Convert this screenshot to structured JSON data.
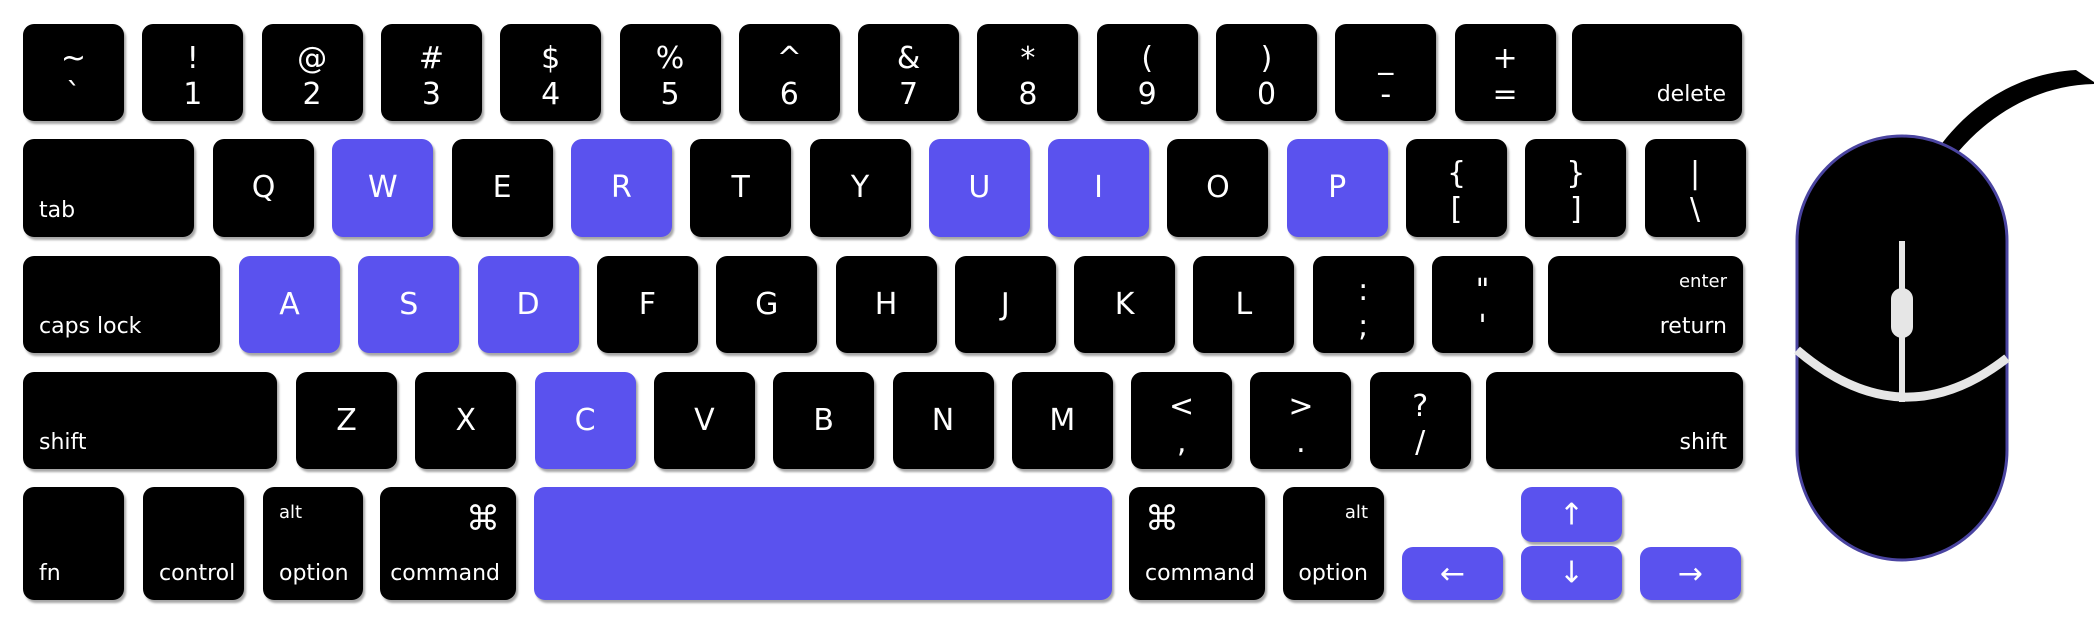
{
  "colors": {
    "highlight": "#5a52ee",
    "key": "#000000",
    "mouse_outline": "#4a44a0",
    "mouse_lines": "#e6e6e6"
  },
  "highlighted_keys": [
    "W",
    "R",
    "U",
    "I",
    "P",
    "A",
    "S",
    "D",
    "C",
    "space",
    "up",
    "down",
    "left",
    "right"
  ],
  "rows": [
    [
      {
        "id": "backtick",
        "top": "~",
        "bottom": "`"
      },
      {
        "id": "1",
        "top": "!",
        "bottom": "1"
      },
      {
        "id": "2",
        "top": "@",
        "bottom": "2"
      },
      {
        "id": "3",
        "top": "#",
        "bottom": "3"
      },
      {
        "id": "4",
        "top": "$",
        "bottom": "4"
      },
      {
        "id": "5",
        "top": "%",
        "bottom": "5"
      },
      {
        "id": "6",
        "top": "^",
        "bottom": "6"
      },
      {
        "id": "7",
        "top": "&",
        "bottom": "7"
      },
      {
        "id": "8",
        "top": "*",
        "bottom": "8"
      },
      {
        "id": "9",
        "top": "(",
        "bottom": "9"
      },
      {
        "id": "0",
        "top": ")",
        "bottom": "0"
      },
      {
        "id": "minus",
        "top": "_",
        "bottom": "-"
      },
      {
        "id": "equals",
        "top": "+",
        "bottom": "="
      },
      {
        "id": "delete",
        "label": "delete",
        "align": "right"
      }
    ],
    [
      {
        "id": "tab",
        "label": "tab",
        "align": "left"
      },
      {
        "id": "Q",
        "char": "Q"
      },
      {
        "id": "W",
        "char": "W"
      },
      {
        "id": "E",
        "char": "E"
      },
      {
        "id": "R",
        "char": "R"
      },
      {
        "id": "T",
        "char": "T"
      },
      {
        "id": "Y",
        "char": "Y"
      },
      {
        "id": "U",
        "char": "U"
      },
      {
        "id": "I",
        "char": "I"
      },
      {
        "id": "O",
        "char": "O"
      },
      {
        "id": "P",
        "char": "P"
      },
      {
        "id": "lbracket",
        "top": "{",
        "bottom": "["
      },
      {
        "id": "rbracket",
        "top": "}",
        "bottom": "]"
      },
      {
        "id": "backslash",
        "top": "|",
        "bottom": "\\"
      }
    ],
    [
      {
        "id": "capslock",
        "label": "caps lock",
        "align": "left"
      },
      {
        "id": "A",
        "char": "A"
      },
      {
        "id": "S",
        "char": "S"
      },
      {
        "id": "D",
        "char": "D"
      },
      {
        "id": "F",
        "char": "F"
      },
      {
        "id": "G",
        "char": "G"
      },
      {
        "id": "H",
        "char": "H"
      },
      {
        "id": "J",
        "char": "J"
      },
      {
        "id": "K",
        "char": "K"
      },
      {
        "id": "L",
        "char": "L"
      },
      {
        "id": "semicolon",
        "top": ":",
        "bottom": ";"
      },
      {
        "id": "quote",
        "top": "\"",
        "bottom": "'"
      },
      {
        "id": "return",
        "label": "return",
        "sub": "enter",
        "align": "right"
      }
    ],
    [
      {
        "id": "lshift",
        "label": "shift",
        "align": "left"
      },
      {
        "id": "Z",
        "char": "Z"
      },
      {
        "id": "X",
        "char": "X"
      },
      {
        "id": "C",
        "char": "C"
      },
      {
        "id": "V",
        "char": "V"
      },
      {
        "id": "B",
        "char": "B"
      },
      {
        "id": "N",
        "char": "N"
      },
      {
        "id": "M",
        "char": "M"
      },
      {
        "id": "comma",
        "top": "<",
        "bottom": ","
      },
      {
        "id": "period",
        "top": ">",
        "bottom": "."
      },
      {
        "id": "slash",
        "top": "?",
        "bottom": "/"
      },
      {
        "id": "rshift",
        "label": "shift",
        "align": "right"
      }
    ],
    [
      {
        "id": "fn",
        "label": "fn",
        "align": "left"
      },
      {
        "id": "control",
        "label": "control",
        "align": "left"
      },
      {
        "id": "loption",
        "label": "option",
        "sub": "alt",
        "align": "left"
      },
      {
        "id": "lcommand",
        "label": "command",
        "cmd": "⌘",
        "align": "right"
      },
      {
        "id": "space"
      },
      {
        "id": "rcommand",
        "label": "command",
        "cmd": "⌘",
        "align": "left"
      },
      {
        "id": "roption",
        "label": "option",
        "sub": "alt",
        "align": "right"
      },
      {
        "id": "left",
        "arrow": "←"
      },
      {
        "id": "up",
        "arrow": "↑"
      },
      {
        "id": "down",
        "arrow": "↓"
      },
      {
        "id": "right",
        "arrow": "→"
      }
    ]
  ],
  "mouse": {
    "label": "mouse"
  }
}
